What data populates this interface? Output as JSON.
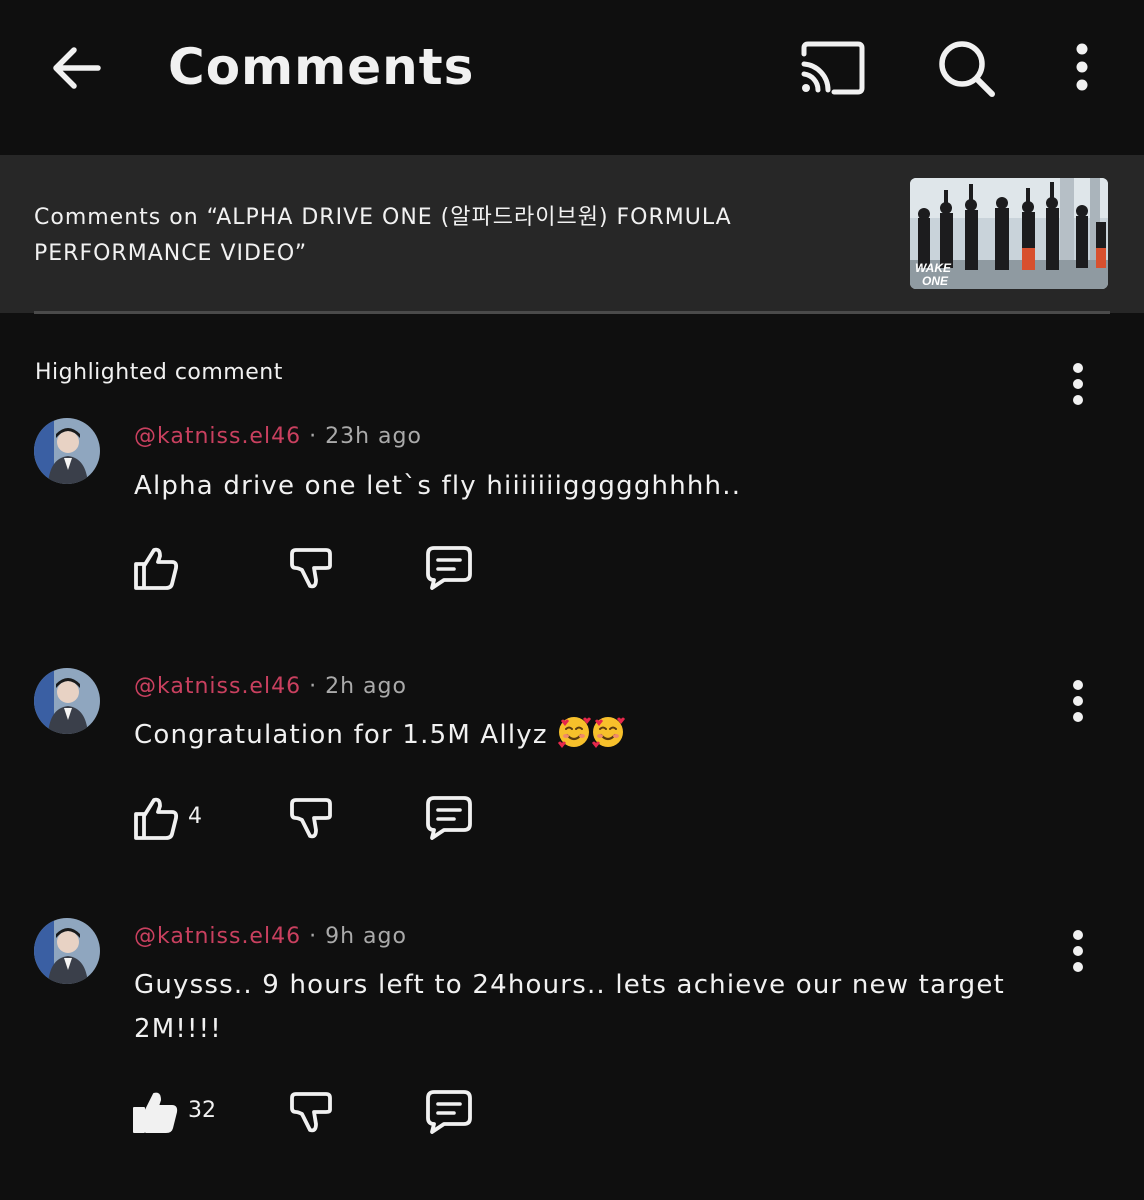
{
  "header": {
    "title": "Comments",
    "icons": [
      "back-arrow-icon",
      "cast-icon",
      "search-icon",
      "more-vert-icon"
    ]
  },
  "video": {
    "comments_on_label": "Comments on “ALPHA DRIVE ONE (알파드라이브원) FORMULA PERFORMANCE VIDEO”",
    "thumbnail_watermark_top": "WAKE",
    "thumbnail_watermark_bottom": "ONE"
  },
  "section": {
    "highlighted_label": "Highlighted comment"
  },
  "comments": [
    {
      "handle": "@katniss.el46",
      "separator": "·",
      "time": "23h ago",
      "text": "Alpha drive one let`s fly hiiiiiiiggggghhhh..",
      "emoji_count": 0,
      "likes": "",
      "liked": false
    },
    {
      "handle": "@katniss.el46",
      "separator": "·",
      "time": "2h ago",
      "text": "Congratulation for 1.5M Allyz",
      "emoji_count": 2,
      "likes": "4",
      "liked": false
    },
    {
      "handle": "@katniss.el46",
      "separator": "·",
      "time": "9h ago",
      "text": "Guysss.. 9 hours left to 24hours.. lets achieve our new target 2M!!!!",
      "emoji_count": 0,
      "likes": "32",
      "liked": true
    }
  ],
  "colors": {
    "background": "#0f0f0f",
    "video_bar": "#272727",
    "handle": "#c9405f",
    "secondary_text": "#aaaaaa",
    "primary_text": "#f1f1f1"
  }
}
